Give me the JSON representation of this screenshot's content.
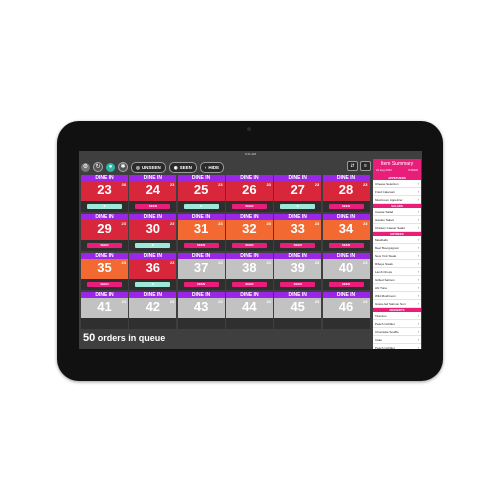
{
  "status_bar": {
    "time": "9:41 AM"
  },
  "toolbar": {
    "unseen_label": "UNSEEN",
    "seen_label": "SEEN",
    "hide_label": "HIDE"
  },
  "colors": {
    "header_purple": "#9b27e6",
    "red": "#d8263a",
    "orange": "#f26a32",
    "grey": "#c2c2c2",
    "teal_action": "#9ee8d9",
    "pink_action": "#e91e7a"
  },
  "tiles": [
    {
      "header": "DINE IN",
      "number": "23",
      "count": "38",
      "state": "red",
      "action": "teal",
      "action_label": "★"
    },
    {
      "header": "DINE IN",
      "number": "24",
      "count": "23",
      "state": "red",
      "action": "pink",
      "action_label": "SEEN"
    },
    {
      "header": "DINE IN",
      "number": "25",
      "count": "23",
      "state": "red",
      "action": "teal",
      "action_label": "★"
    },
    {
      "header": "DINE IN",
      "number": "26",
      "count": "23",
      "state": "red",
      "action": "pink",
      "action_label": "SEEN"
    },
    {
      "header": "DINE IN",
      "number": "27",
      "count": "23",
      "state": "red",
      "action": "teal",
      "action_label": "★"
    },
    {
      "header": "DINE IN",
      "number": "28",
      "count": "23",
      "state": "red",
      "action": "pink",
      "action_label": "SEEN"
    },
    {
      "header": "DINE IN",
      "number": "29",
      "count": "23",
      "state": "red",
      "action": "pink",
      "action_label": "SEEN"
    },
    {
      "header": "DINE IN",
      "number": "30",
      "count": "23",
      "state": "red",
      "action": "teal",
      "action_label": "★"
    },
    {
      "header": "DINE IN",
      "number": "31",
      "count": "23",
      "state": "orange",
      "action": "pink",
      "action_label": "SEEN"
    },
    {
      "header": "DINE IN",
      "number": "32",
      "count": "23",
      "state": "orange",
      "action": "pink",
      "action_label": "SEEN"
    },
    {
      "header": "DINE IN",
      "number": "33",
      "count": "23",
      "state": "orange",
      "action": "pink",
      "action_label": "SEEN"
    },
    {
      "header": "DINE IN",
      "number": "34",
      "count": "23",
      "state": "orange",
      "action": "pink",
      "action_label": "SEEN"
    },
    {
      "header": "DINE IN",
      "number": "35",
      "count": "23",
      "state": "orange",
      "action": "pink",
      "action_label": "SEEN"
    },
    {
      "header": "DINE IN",
      "number": "36",
      "count": "23",
      "state": "red",
      "action": "teal",
      "action_label": "★"
    },
    {
      "header": "DINE IN",
      "number": "37",
      "count": "23",
      "state": "grey",
      "action": "pink",
      "action_label": "SEEN"
    },
    {
      "header": "DINE IN",
      "number": "38",
      "count": "23",
      "state": "grey",
      "action": "pink",
      "action_label": "SEEN"
    },
    {
      "header": "DINE IN",
      "number": "39",
      "count": "23",
      "state": "grey",
      "action": "pink",
      "action_label": "SEEN"
    },
    {
      "header": "DINE IN",
      "number": "40",
      "count": "23",
      "state": "grey",
      "action": "pink",
      "action_label": "SEEN"
    },
    {
      "header": "DINE IN",
      "number": "41",
      "count": "23",
      "state": "grey",
      "action": "none",
      "action_label": ""
    },
    {
      "header": "DINE IN",
      "number": "42",
      "count": "23",
      "state": "grey",
      "action": "none",
      "action_label": ""
    },
    {
      "header": "DINE IN",
      "number": "43",
      "count": "23",
      "state": "grey",
      "action": "none",
      "action_label": ""
    },
    {
      "header": "DINE IN",
      "number": "44",
      "count": "23",
      "state": "grey",
      "action": "none",
      "action_label": ""
    },
    {
      "header": "DINE IN",
      "number": "45",
      "count": "23",
      "state": "grey",
      "action": "none",
      "action_label": ""
    },
    {
      "header": "DINE IN",
      "number": "46",
      "count": "23",
      "state": "grey",
      "action": "none",
      "action_label": ""
    }
  ],
  "queue": {
    "count": "50",
    "label": "orders in queue"
  },
  "summary": {
    "title": "Item Summary",
    "date": "21 Aug 2023",
    "code": "8:00AM",
    "sections": [
      {
        "name": "APPETIZERS",
        "items": [
          "Cheese Selection",
          "Fried Calamari",
          "Mushroom Appetizer"
        ]
      },
      {
        "name": "SALADS",
        "items": [
          "Caesar Salad",
          "Garden Salad",
          "Chicken Caesar Salad"
        ]
      },
      {
        "name": "ENTREES",
        "items": [
          "Meatballs",
          "Beef Bourguignon",
          "New York Steak",
          "Ribeye Steak",
          "Lamb Chops",
          "Grilled Salmon",
          "Ahi Tuna",
          "Wild Mushroom",
          "Grass-fed Salmon Nori"
        ]
      },
      {
        "name": "DESSERTS",
        "items": [
          "Tiramisu",
          "Peach Cobbler",
          "Chocolate Souffle",
          "Cake",
          "Peach Cobbler"
        ]
      }
    ]
  }
}
